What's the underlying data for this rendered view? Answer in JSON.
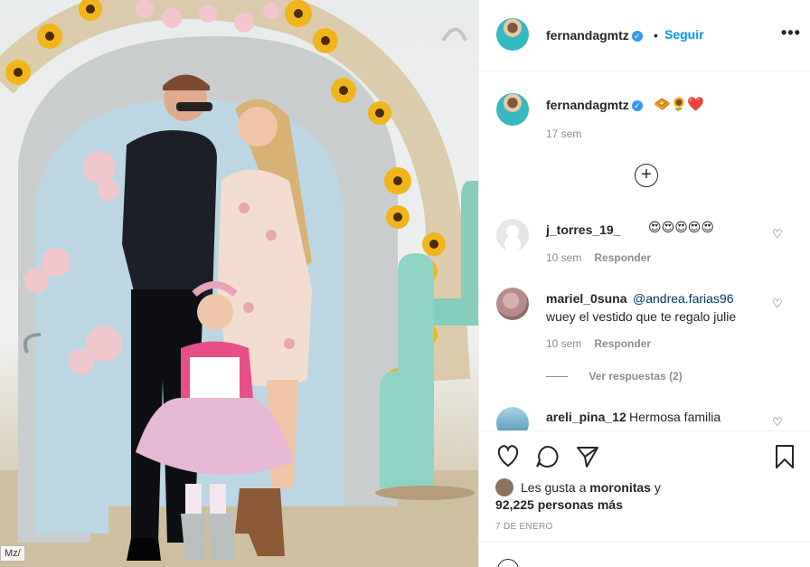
{
  "post": {
    "username": "fernandagmtz",
    "verified_mark": "✓",
    "dot": "•",
    "follow_label": "Seguir",
    "more_label": "•••"
  },
  "photo": {
    "watermark": "Mz/"
  },
  "caption": {
    "username": "fernandagmtz",
    "emojis": "🧇🌻❤️",
    "time": "17 sem"
  },
  "load_more": {
    "label": "+"
  },
  "comments": [
    {
      "username": "j_torres_19_",
      "text": "😍😍😍😍😍",
      "time": "10 sem",
      "reply": "Responder"
    },
    {
      "username": "mariel_0suna",
      "mention": "@andrea.farias96",
      "text": "wuey el vestido que te regalo julie",
      "time": "10 sem",
      "reply": "Responder",
      "view_replies": "Ver respuestas (2)"
    },
    {
      "username": "areli_pina_12",
      "text": "Hermosa familia"
    }
  ],
  "icons": {
    "heart_small": "♡"
  },
  "likes": {
    "prefix": "Les gusta a",
    "liker": "moronitas",
    "joiner": "y",
    "count_text": "92,225 personas más"
  },
  "date": "7 DE ENERO"
}
